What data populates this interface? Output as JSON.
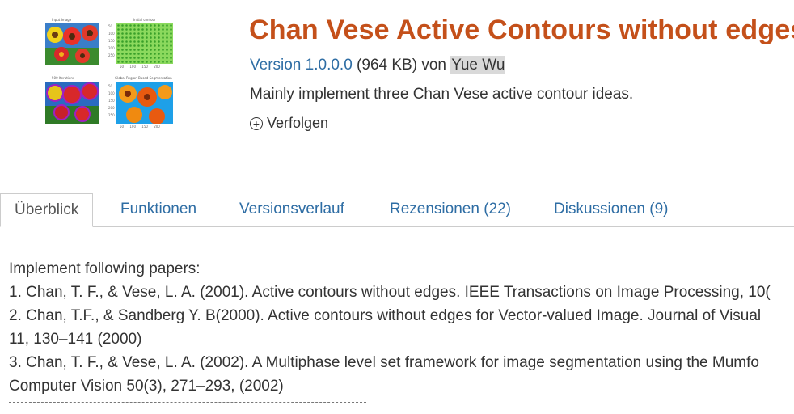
{
  "thumbnail": {
    "panels": [
      {
        "title": "Input Image"
      },
      {
        "title": "Initial contour"
      },
      {
        "title": "500 Iterations"
      },
      {
        "title": "Global Region-Based Segmentation"
      }
    ],
    "ticks_y": [
      "50",
      "100",
      "150",
      "200",
      "250"
    ],
    "ticks_x": [
      "50",
      "100",
      "150",
      "200",
      "250"
    ]
  },
  "header": {
    "title": "Chan Vese Active Contours without edges",
    "version_label": "Version 1.0.0.0",
    "size": "(964 KB)",
    "by": "von",
    "author": "Yue Wu",
    "summary": "Mainly implement three Chan Vese active contour ideas.",
    "follow_label": "Verfolgen"
  },
  "tabs": [
    {
      "label": "Überblick",
      "active": true
    },
    {
      "label": "Funktionen"
    },
    {
      "label": "Versionsverlauf"
    },
    {
      "label": "Rezensionen (22)"
    },
    {
      "label": "Diskussionen (9)"
    }
  ],
  "description": {
    "lines": [
      "Implement following papers:",
      "1. Chan, T. F., & Vese, L. A. (2001). Active contours without edges. IEEE Transactions on Image Processing, 10(",
      "2. Chan, T.F., & Sandberg Y. B(2000). Active contours without edges for Vector-valued Image. Journal of Visual",
      "11, 130–141 (2000)",
      "3. Chan, T. F., & Vese, L. A. (2002). A Multiphase level set framework for image segmentation using the Mumfo",
      "Computer Vision 50(3), 271–293, (2002)"
    ],
    "separator": "-----------------------------------------------------------------------------------------"
  },
  "colors": {
    "title": "#c4501a",
    "link": "#2e6da4",
    "author_bg": "#d9d9d9"
  },
  "icons": {
    "follow": "plus-circle-icon"
  }
}
